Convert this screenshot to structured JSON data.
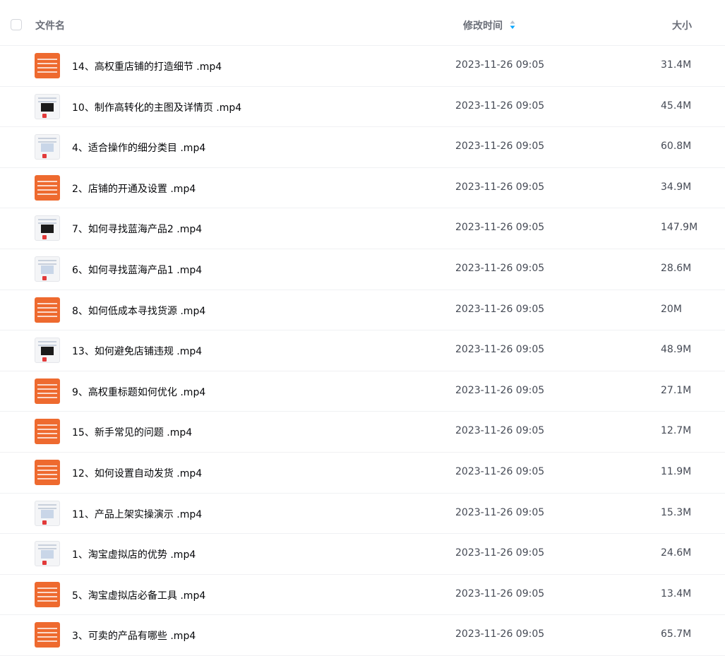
{
  "header": {
    "name_label": "文件名",
    "time_label": "修改时间",
    "size_label": "大小"
  },
  "colors": {
    "accent": "#06a7ff",
    "thumb_orange": "#ee6a2f"
  },
  "files": [
    {
      "name": "14、高权重店铺的打造细节 .mp4",
      "time": "2023-11-26 09:05",
      "size": "31.4M",
      "thumb": "orange"
    },
    {
      "name": "10、制作高转化的主图及详情页 .mp4",
      "time": "2023-11-26 09:05",
      "size": "45.4M",
      "thumb": "white"
    },
    {
      "name": "4、适合操作的细分类目 .mp4",
      "time": "2023-11-26 09:05",
      "size": "60.8M",
      "thumb": "white"
    },
    {
      "name": "2、店铺的开通及设置 .mp4",
      "time": "2023-11-26 09:05",
      "size": "34.9M",
      "thumb": "orange"
    },
    {
      "name": "7、如何寻找蓝海产品2 .mp4",
      "time": "2023-11-26 09:05",
      "size": "147.9M",
      "thumb": "white"
    },
    {
      "name": "6、如何寻找蓝海产品1 .mp4",
      "time": "2023-11-26 09:05",
      "size": "28.6M",
      "thumb": "white"
    },
    {
      "name": "8、如何低成本寻找货源 .mp4",
      "time": "2023-11-26 09:05",
      "size": "20M",
      "thumb": "orange"
    },
    {
      "name": "13、如何避免店铺违规 .mp4",
      "time": "2023-11-26 09:05",
      "size": "48.9M",
      "thumb": "white"
    },
    {
      "name": "9、高权重标题如何优化 .mp4",
      "time": "2023-11-26 09:05",
      "size": "27.1M",
      "thumb": "orange"
    },
    {
      "name": "15、新手常见的问题 .mp4",
      "time": "2023-11-26 09:05",
      "size": "12.7M",
      "thumb": "orange"
    },
    {
      "name": "12、如何设置自动发货 .mp4",
      "time": "2023-11-26 09:05",
      "size": "11.9M",
      "thumb": "orange"
    },
    {
      "name": "11、产品上架实操演示 .mp4",
      "time": "2023-11-26 09:05",
      "size": "15.3M",
      "thumb": "white"
    },
    {
      "name": "1、淘宝虚拟店的优势 .mp4",
      "time": "2023-11-26 09:05",
      "size": "24.6M",
      "thumb": "white"
    },
    {
      "name": "5、淘宝虚拟店必备工具 .mp4",
      "time": "2023-11-26 09:05",
      "size": "13.4M",
      "thumb": "orange"
    },
    {
      "name": "3、可卖的产品有哪些 .mp4",
      "time": "2023-11-26 09:05",
      "size": "65.7M",
      "thumb": "orange"
    }
  ]
}
